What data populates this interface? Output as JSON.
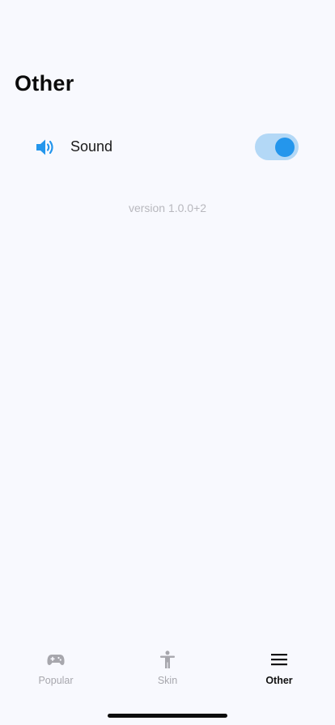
{
  "page": {
    "title": "Other"
  },
  "settings": {
    "sound": {
      "label": "Sound",
      "icon": "speaker-volume-icon",
      "enabled": true
    }
  },
  "footer": {
    "version": "version 1.0.0+2"
  },
  "tabs": [
    {
      "label": "Popular",
      "icon": "gamepad-icon",
      "active": false
    },
    {
      "label": "Skin",
      "icon": "person-figure-icon",
      "active": false
    },
    {
      "label": "Other",
      "icon": "menu-lines-icon",
      "active": true
    }
  ],
  "colors": {
    "accent": "#2496ec",
    "toggle_track": "#b3d8f6",
    "background": "#f8f9fe",
    "inactive_tab": "#a7a7ad",
    "version_text": "#b8b8be"
  }
}
